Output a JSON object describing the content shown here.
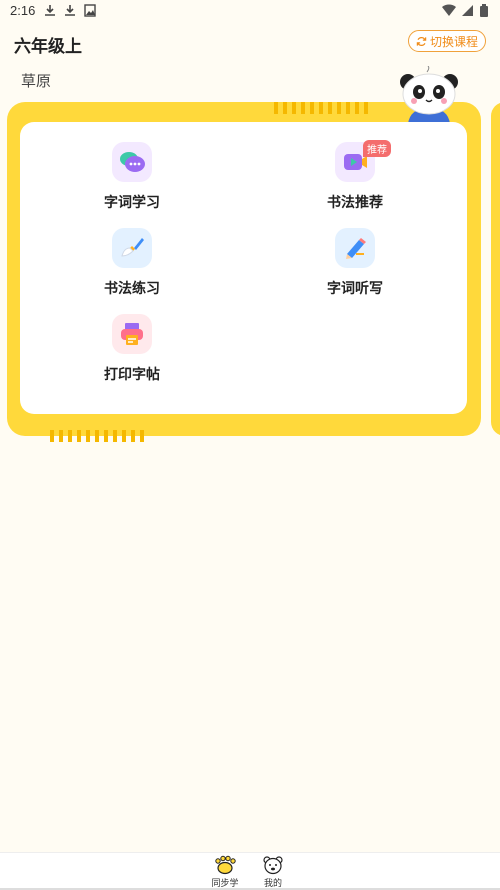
{
  "status_bar": {
    "time": "2:16",
    "left_icons": [
      "download-icon",
      "download-icon",
      "image-icon"
    ],
    "right_icons": [
      "wifi-icon",
      "cellular-icon",
      "battery-icon"
    ]
  },
  "header": {
    "title": "六年级上",
    "switch_label": "切换课程"
  },
  "section": {
    "label": "草原"
  },
  "tiles": [
    {
      "label": "字词学习",
      "icon": "chat-bubbles-icon"
    },
    {
      "label": "书法推荐",
      "icon": "video-play-icon",
      "badge": "推荐"
    },
    {
      "label": "书法练习",
      "icon": "brush-icon"
    },
    {
      "label": "字词听写",
      "icon": "pencil-icon"
    },
    {
      "label": "打印字帖",
      "icon": "printer-icon"
    }
  ],
  "bottom_nav": [
    {
      "label": "同步学",
      "icon": "paw-icon",
      "active": true
    },
    {
      "label": "我的",
      "icon": "bear-face-icon",
      "active": false
    }
  ],
  "colors": {
    "background": "#fffcf3",
    "card_yellow": "#ffd93b",
    "accent_orange": "#f08c1a",
    "badge_red": "#f46d6d"
  }
}
